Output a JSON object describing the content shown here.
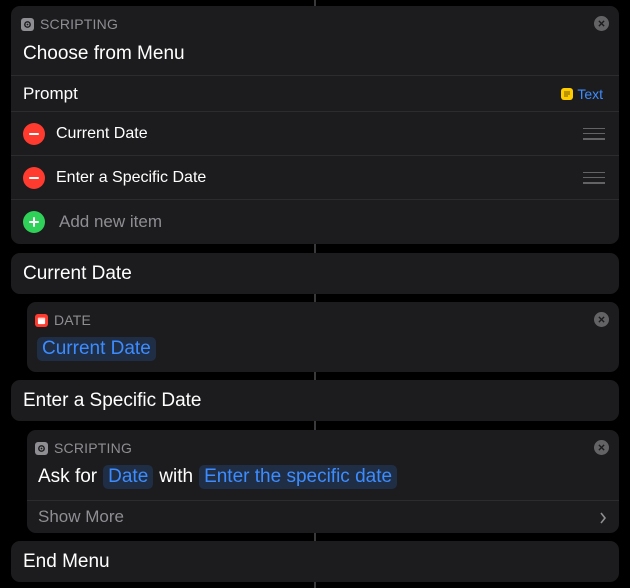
{
  "menu_card": {
    "category": "SCRIPTING",
    "icon": "gear-icon",
    "title": "Choose from Menu",
    "prompt_label": "Prompt",
    "prompt_token": "Text",
    "items": [
      {
        "label": "Current Date"
      },
      {
        "label": "Enter a Specific Date"
      }
    ],
    "add_item_label": "Add new item"
  },
  "branch_current": {
    "label": "Current Date"
  },
  "date_card": {
    "category": "DATE",
    "icon": "calendar-icon",
    "token": "Current Date"
  },
  "branch_specific": {
    "label": "Enter a Specific Date"
  },
  "ask_card": {
    "category": "SCRIPTING",
    "icon": "gear-icon",
    "prefix": "Ask for",
    "type_token": "Date",
    "middle": "with",
    "prompt_token": "Enter the specific date",
    "show_more": "Show More"
  },
  "end_menu": {
    "label": "End Menu"
  },
  "colors": {
    "background": "#000000",
    "card": "#1c1c1e",
    "accent": "#3d8cff",
    "destructive": "#ff3b30",
    "add": "#30d158"
  }
}
